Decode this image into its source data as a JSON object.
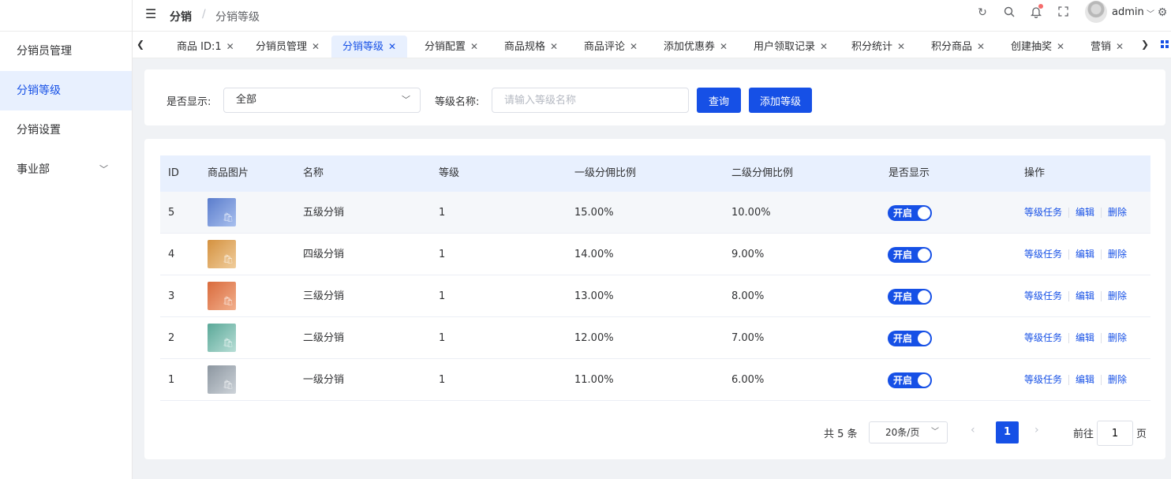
{
  "sidebar": {
    "items": [
      {
        "label": "分销员管理",
        "active": false
      },
      {
        "label": "分销等级",
        "active": true
      },
      {
        "label": "分销设置",
        "active": false
      },
      {
        "label": "事业部",
        "active": false,
        "has_children": true
      }
    ]
  },
  "header": {
    "breadcrumb_main": "分销",
    "breadcrumb_sep": "/",
    "breadcrumb_sub": "分销等级",
    "user_name": "admin",
    "icons": [
      "refresh-icon",
      "search-icon",
      "bell-icon",
      "fullscreen-icon",
      "settings-icon"
    ]
  },
  "tabs": [
    {
      "label": "商品 ID:1",
      "active": false
    },
    {
      "label": "分销员管理",
      "active": false
    },
    {
      "label": "分销等级",
      "active": true
    },
    {
      "label": "分销配置",
      "active": false
    },
    {
      "label": "商品规格",
      "active": false
    },
    {
      "label": "商品评论",
      "active": false
    },
    {
      "label": "添加优惠券",
      "active": false
    },
    {
      "label": "用户领取记录",
      "active": false
    },
    {
      "label": "积分统计",
      "active": false
    },
    {
      "label": "积分商品",
      "active": false
    },
    {
      "label": "创建抽奖",
      "active": false
    },
    {
      "label": "营销",
      "active": false
    }
  ],
  "filter": {
    "show_label": "是否显示:",
    "show_value": "全部",
    "name_label": "等级名称:",
    "name_placeholder": "请输入等级名称",
    "query_button": "查询",
    "add_button": "添加等级"
  },
  "table": {
    "headers": [
      "ID",
      "商品图片",
      "名称",
      "等级",
      "一级分佣比例",
      "二级分佣比例",
      "是否显示",
      "操作"
    ],
    "rows": [
      {
        "id": "5",
        "name": "五级分销",
        "level": "1",
        "rate1": "15.00%",
        "rate2": "10.00%",
        "switch_label": "开启",
        "thumb_color": "#6f8fd8"
      },
      {
        "id": "4",
        "name": "四级分销",
        "level": "1",
        "rate1": "14.00%",
        "rate2": "9.00%",
        "switch_label": "开启",
        "thumb_color": "#d99a4e"
      },
      {
        "id": "3",
        "name": "三级分销",
        "level": "1",
        "rate1": "13.00%",
        "rate2": "8.00%",
        "switch_label": "开启",
        "thumb_color": "#de7a4f"
      },
      {
        "id": "2",
        "name": "二级分销",
        "level": "1",
        "rate1": "12.00%",
        "rate2": "7.00%",
        "switch_label": "开启",
        "thumb_color": "#6bb5a8"
      },
      {
        "id": "1",
        "name": "一级分销",
        "level": "1",
        "rate1": "11.00%",
        "rate2": "6.00%",
        "switch_label": "开启",
        "thumb_color": "#9aa4ae"
      }
    ],
    "actions": {
      "task": "等级任务",
      "edit": "编辑",
      "delete": "删除"
    }
  },
  "pagination": {
    "total": "共 5 条",
    "page_size": "20条/页",
    "current_page": "1",
    "goto_label": "前往",
    "goto_value": "1",
    "page_suffix": "页"
  }
}
